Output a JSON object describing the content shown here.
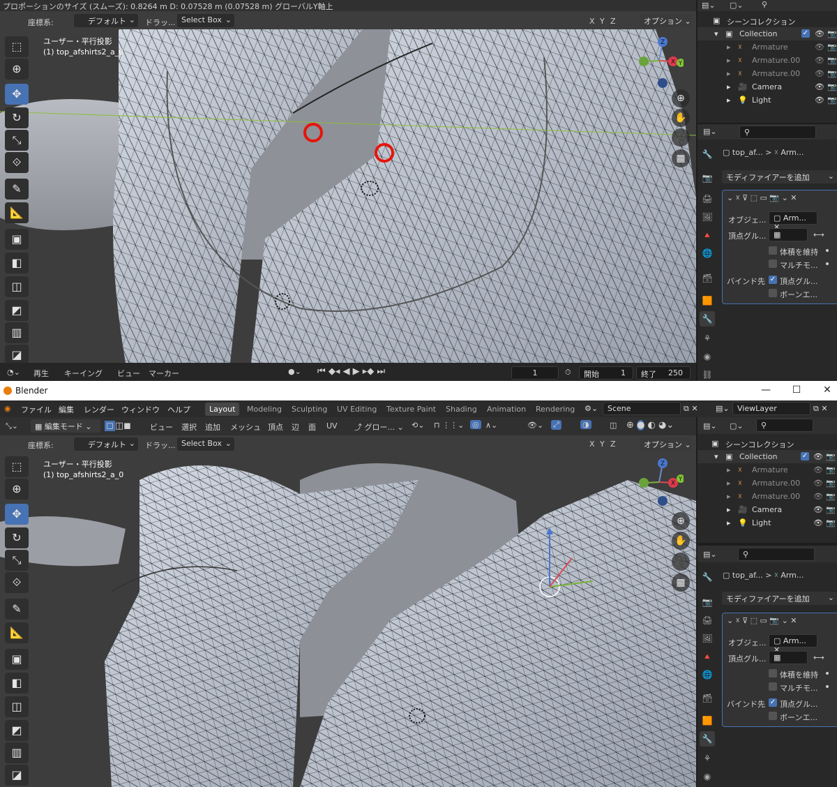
{
  "top": {
    "status_text": "プロポーションのサイズ (スムーズ): 0.8264 m   D: 0.07528 m (0.07528 m) グローバルY軸上",
    "viewport_header": {
      "orientation_label": "座標系:",
      "orientation_value": "デフォルト",
      "drag_label": "ドラッ...",
      "drag_value": "Select Box",
      "axes": [
        "X",
        "Y",
        "Z"
      ],
      "options_label": "オプション"
    },
    "view_name": "ユーザー・平行投影",
    "object_name": "(1) top_afshirts2_a_0",
    "timeline": {
      "playback": "再生",
      "keying": "キーイング",
      "view": "ビュー",
      "marker": "マーカー",
      "current_frame": "1",
      "start_label": "開始",
      "start": "1",
      "end_label": "終了",
      "end": "250"
    }
  },
  "bottom": {
    "window_title": "Blender",
    "menu": [
      "ファイル",
      "編集",
      "レンダー",
      "ウィンドウ",
      "ヘルプ"
    ],
    "workspaces": [
      "Layout",
      "Modeling",
      "Sculpting",
      "UV Editing",
      "Texture Paint",
      "Shading",
      "Animation",
      "Rendering"
    ],
    "active_workspace": "Layout",
    "scene_label": "Scene",
    "view_layer_label": "ViewLayer",
    "edit_header": {
      "mode": "編集モード",
      "view": "ビュー",
      "select": "選択",
      "add": "追加",
      "mesh": "メッシュ",
      "vertex": "頂点",
      "edge": "辺",
      "face": "面",
      "uv": "UV",
      "transform": "グロー..."
    },
    "viewport_header": {
      "orientation_label": "座標系:",
      "orientation_value": "デフォルト",
      "drag_label": "ドラッ...",
      "drag_value": "Select Box",
      "axes": [
        "X",
        "Y",
        "Z"
      ],
      "options_label": "オプション"
    },
    "view_name": "ユーザー・平行投影",
    "object_name": "(1) top_afshirts2_a_0"
  },
  "outliner": {
    "scene_collection": "シーンコレクション",
    "collection": "Collection",
    "items": [
      "Armature",
      "Armature.00",
      "Armature.00",
      "Camera",
      "Light"
    ]
  },
  "properties": {
    "breadcrumb_object": "top_af...",
    "breadcrumb_modifier": "Arm...",
    "add_modifier": "モディファイアーを追加",
    "object_label": "オブジェ...",
    "object_value": "Arm...",
    "vertex_group_label": "頂点グル...",
    "preserve_volume": "体積を維持",
    "multi_modifier": "マルチモ...",
    "bind_to_label": "バインド先",
    "bind_vertex_groups": "頂点グル...",
    "bind_bone_envelopes": "ボーンエ..."
  },
  "colors": {
    "accent": "#4772b3",
    "viewport_bg": "#3d3d3d",
    "highlight_circle": "#e8140a",
    "panel_bg": "#282828"
  }
}
